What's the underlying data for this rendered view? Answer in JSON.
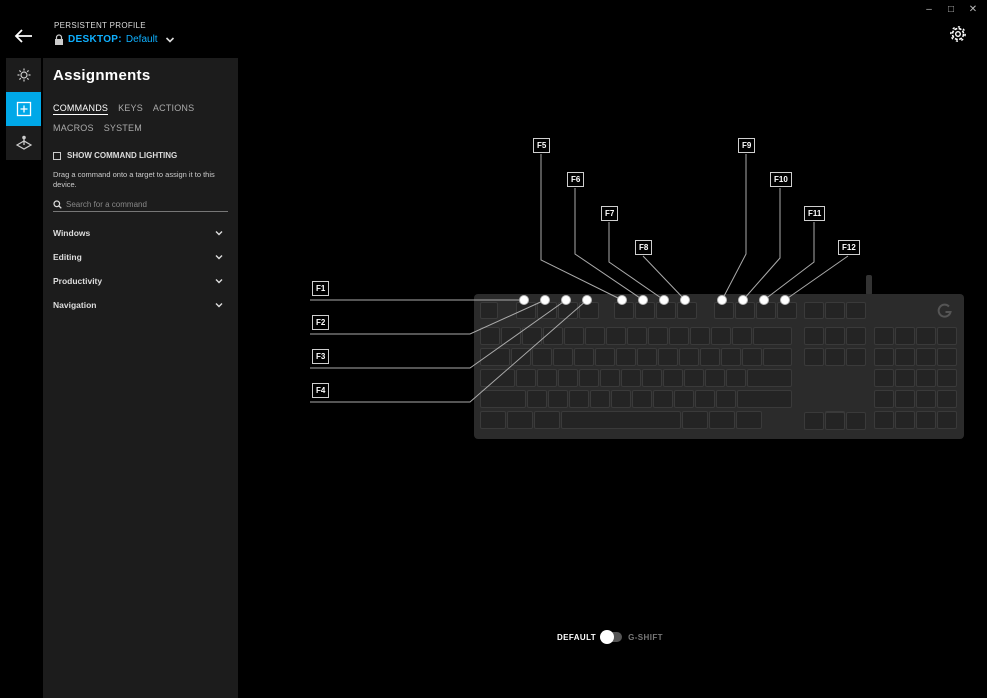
{
  "window": {
    "minimize": "–",
    "maximize": "□",
    "close": "✕"
  },
  "header": {
    "profile_label": "PERSISTENT PROFILE",
    "profile_prefix": "DESKTOP:",
    "profile_value": "Default"
  },
  "panel": {
    "title": "Assignments",
    "tabs": [
      {
        "label": "COMMANDS",
        "active": true
      },
      {
        "label": "KEYS"
      },
      {
        "label": "ACTIONS"
      },
      {
        "label": "MACROS"
      },
      {
        "label": "SYSTEM"
      }
    ],
    "show_lighting_label": "SHOW COMMAND LIGHTING",
    "hint": "Drag a command onto a target to assign it to this device.",
    "search_placeholder": "Search for a command",
    "categories": [
      "Windows",
      "Editing",
      "Productivity",
      "Navigation"
    ]
  },
  "fkeys": [
    "F1",
    "F2",
    "F3",
    "F4",
    "F5",
    "F6",
    "F7",
    "F8",
    "F9",
    "F10",
    "F11",
    "F12"
  ],
  "mode_toggle": {
    "default_label": "DEFAULT",
    "gshift_label": "G-SHIFT"
  },
  "colors": {
    "accent": "#00a8e8",
    "link": "#0fb0ff",
    "panel_bg": "#1c1c1c",
    "keyboard_bg": "#2b2b2b"
  },
  "icons": {
    "back": "arrow-left-icon",
    "lock": "lock-icon",
    "dropdown": "chevron-down-icon",
    "settings": "gear-icon",
    "lighting": "brightness-icon",
    "assignments": "plus-square-icon",
    "heatmap": "joystick-icon",
    "search": "search-icon",
    "logo": "g-logo-icon"
  }
}
